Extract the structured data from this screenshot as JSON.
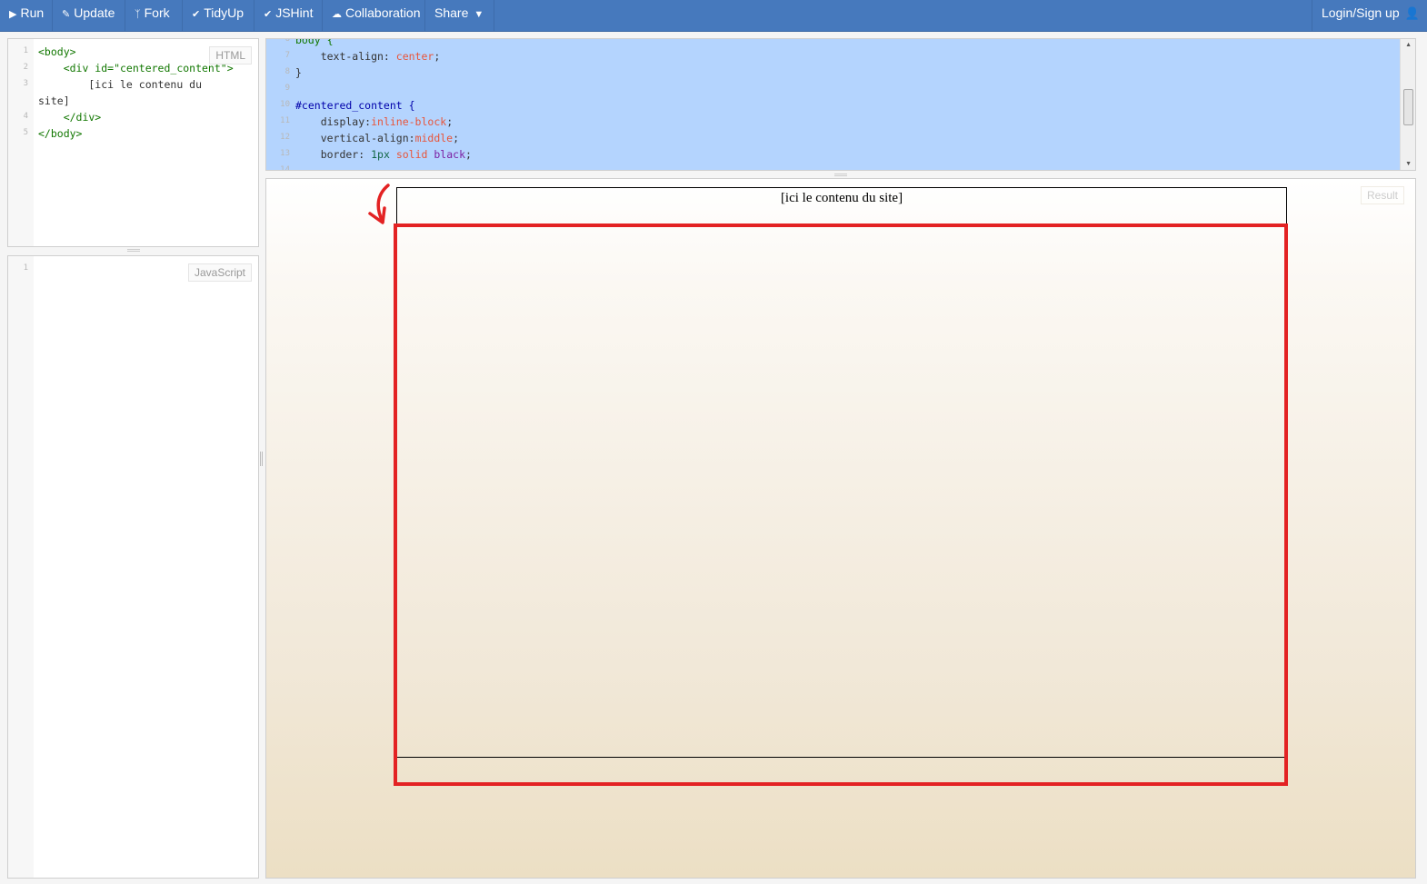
{
  "toolbar": {
    "run": "Run",
    "update": "Update",
    "fork": "Fork",
    "tidyup": "TidyUp",
    "jshint": "JSHint",
    "collaboration": "Collaboration",
    "share": "Share",
    "login": "Login/Sign up"
  },
  "html_panel": {
    "label": "HTML",
    "line_numbers": [
      "1",
      "2",
      "3",
      "",
      "4",
      "5"
    ],
    "lines": [
      "<body>",
      "    <div id=\"centered_content\">",
      "        [ici le contenu du",
      "site]",
      "    </div>",
      "</body>"
    ]
  },
  "js_panel": {
    "label": "JavaScript",
    "line_numbers": [
      "1"
    ]
  },
  "css_panel": {
    "line_numbers": [
      "6",
      "7",
      "8",
      "9",
      "10",
      "11",
      "12",
      "13",
      "14"
    ],
    "lines": [
      "body {",
      "    text-align: center;",
      "}",
      "",
      "#centered_content {",
      "    display:inline-block;",
      "    vertical-align:middle;",
      "    border: 1px solid black;",
      ""
    ]
  },
  "result_panel": {
    "label": "Result",
    "content_text": "[ici le contenu du site]"
  },
  "colors": {
    "toolbar": "#4679bd",
    "selection": "#b4d4fe",
    "highlight_box": "#e32223"
  }
}
